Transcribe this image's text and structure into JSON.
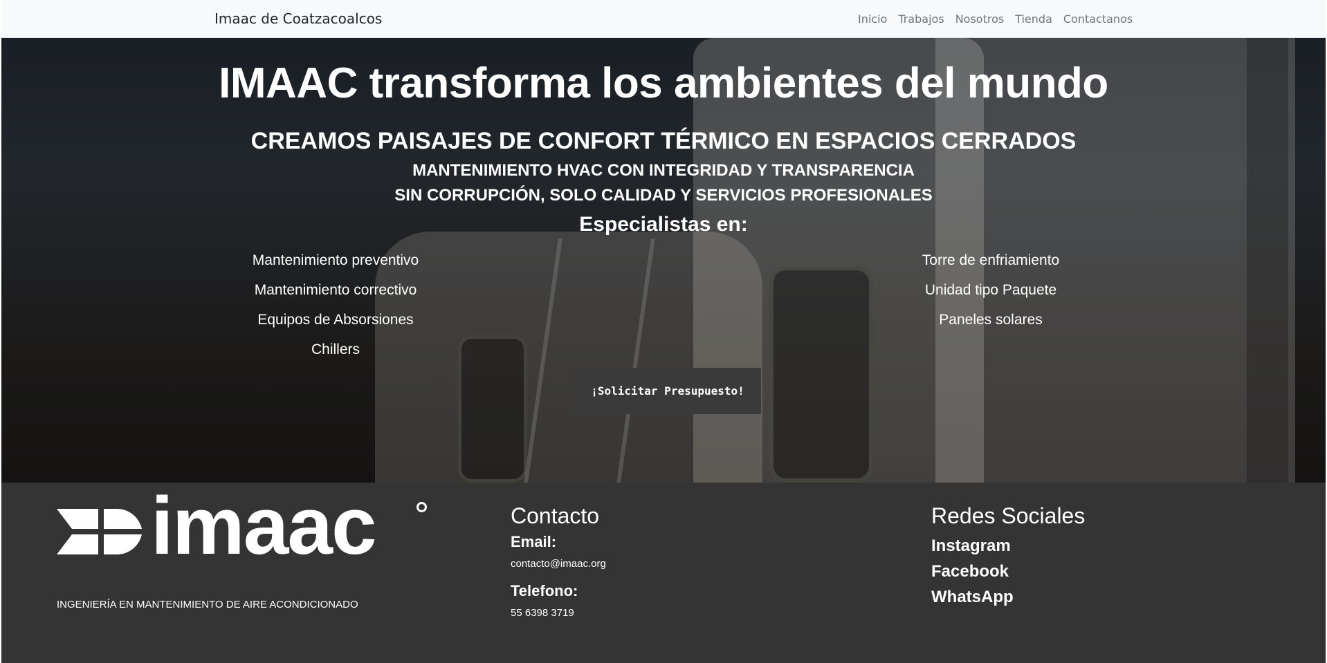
{
  "navbar": {
    "brand": "Imaac de Coatzacoalcos",
    "links": [
      "Inicio",
      "Trabajos",
      "Nosotros",
      "Tienda",
      "Contactanos"
    ]
  },
  "hero": {
    "title": "IMAAC transforma los ambientes del mundo",
    "subtitle1": "CREAMOS PAISAJES DE CONFORT TÉRMICO EN ESPACIOS CERRADOS",
    "subtitle2": "MANTENIMIENTO HVAC CON INTEGRIDAD Y TRANSPARENCIA",
    "subtitle3": "SIN CORRUPCIÓN, SOLO CALIDAD Y SERVICIOS PROFESIONALES",
    "specialists_heading": "Especialistas en:",
    "left_services": [
      "Mantenimiento preventivo",
      "Mantenimiento correctivo",
      "Equipos de Absorsiones",
      "Chillers"
    ],
    "right_services": [
      "Torre de enfriamiento",
      "Unidad tipo Paquete",
      "Paneles solares"
    ],
    "cta_label": "¡Solicitar Presupuesto!"
  },
  "footer": {
    "logo_text": "imaac",
    "tagline": "INGENIERÍA EN MANTENIMIENTO DE AIRE ACONDICIONADO",
    "contact": {
      "title": "Contacto",
      "email_label": "Email:",
      "email": "contacto@imaac.org",
      "phone_label": "Telefono:",
      "phone": "55 6398 3719"
    },
    "social": {
      "title": "Redes Sociales",
      "links": [
        "Instagram",
        "Facebook",
        "WhatsApp"
      ]
    }
  },
  "colors": {
    "navbar_bg": "#f8f9fa",
    "footer_bg": "#343434",
    "cta_bg": "#3a3a3a",
    "text_light": "#ffffff"
  }
}
